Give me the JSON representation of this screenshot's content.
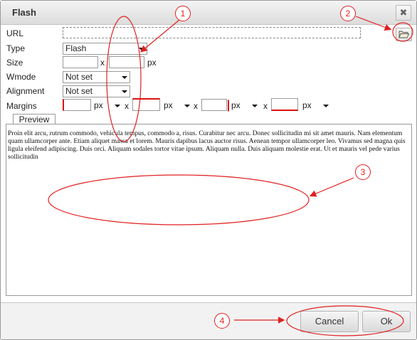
{
  "dialog": {
    "title": "Flash",
    "close_glyph": "✖"
  },
  "fields": {
    "url_label": "URL",
    "url_value": "",
    "type_label": "Type",
    "type_value": "Flash",
    "size_label": "Size",
    "size_width": "",
    "size_height": "",
    "size_separator": "x",
    "size_unit": "px",
    "wmode_label": "Wmode",
    "wmode_value": "Not set",
    "alignment_label": "Alignment",
    "alignment_value": "Not set",
    "margins_label": "Margins",
    "margin_separator": "x",
    "margin_unit": "px",
    "margins": [
      "",
      "",
      "",
      ""
    ]
  },
  "preview": {
    "tab_label": "Preview",
    "text": "Proin elit arcu, rutrum commodo, vehicula tempus, commodo a, risus. Curabitur nec arcu. Donec sollicitudin mi sit amet mauris. Nam elementum quam ullamcorper ante. Etiam aliquet massa et lorem. Mauris dapibus lacus auctor risus. Aenean tempor ullamcorper leo. Vivamus sed magna quis ligula eleifend adipiscing. Duis orci. Aliquam sodales tortor vitae ipsum. Aliquam nulla. Duis aliquam molestie erat. Ut et mauris vel pede varius sollicitudin"
  },
  "buttons": {
    "cancel": "Cancel",
    "ok": "Ok"
  },
  "annotations": [
    "1",
    "2",
    "3",
    "4"
  ],
  "icons": {
    "browse": "folder-open-icon",
    "close": "close-icon"
  },
  "colors": {
    "annotation": "#e02020",
    "required_field": "#d11111"
  }
}
